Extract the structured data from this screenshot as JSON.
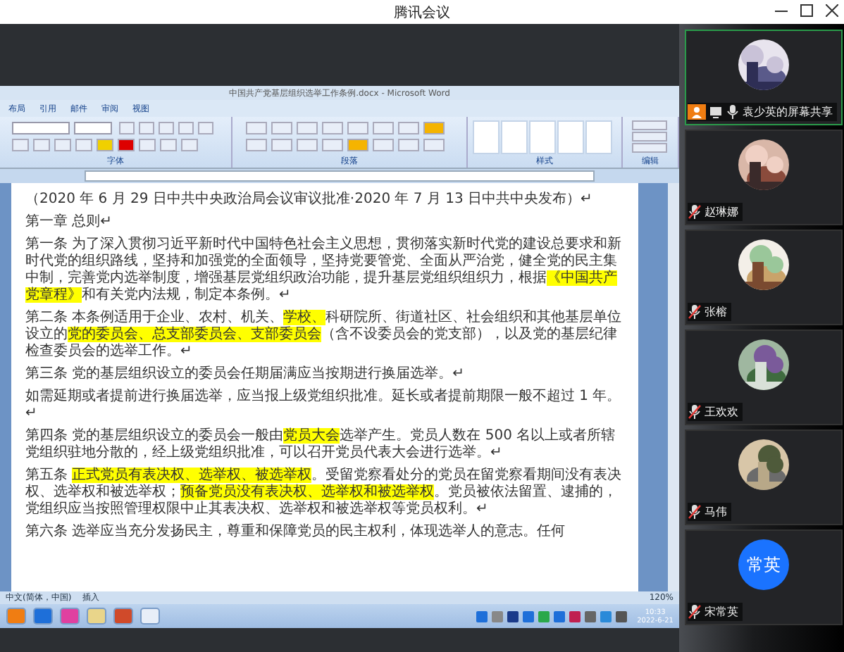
{
  "window": {
    "title": "腾讯会议"
  },
  "shared_screen": {
    "word": {
      "title": "中国共产党基层组织选举工作条例.docx - Microsoft Word",
      "tabs": [
        {
          "label": "布局",
          "selected": false
        },
        {
          "label": "引用",
          "selected": false
        },
        {
          "label": "邮件",
          "selected": false
        },
        {
          "label": "审阅",
          "selected": false
        },
        {
          "label": "视图",
          "selected": false
        }
      ],
      "ribbon_groups": [
        {
          "kind": "font",
          "label": "字体"
        },
        {
          "kind": "paragraph",
          "label": "段落"
        },
        {
          "kind": "styles",
          "label": "样式"
        },
        {
          "kind": "editing",
          "label": "编辑"
        }
      ],
      "document": [
        {
          "segments": [
            {
              "text": "（2020 年 6 月 29 日中共中央政治局会议审议批准·2020 年 7 月 13 日中共中央发布）↵",
              "highlight": false
            }
          ]
        },
        {
          "segments": [
            {
              "text": "第一章 总则↵",
              "highlight": false
            }
          ]
        },
        {
          "segments": [
            {
              "text": "第一条 为了深入贯彻习近平新时代中国特色社会主义思想，贯彻落实新时代党的建设总要求和新时代党的组织路线，坚持和加强党的全面领导，坚持党要管党、全面从严治党，健全党的民主集中制，完善党内选举制度，增强基层党组织政治功能，提升基层党组织组织力，根据",
              "highlight": false
            },
            {
              "text": "《中国共产党章程》",
              "highlight": true
            },
            {
              "text": "和有关党内法规，制定本条例。↵",
              "highlight": false
            }
          ]
        },
        {
          "segments": [
            {
              "text": "第二条 本条例适用于企业、农村、机关、",
              "highlight": false
            },
            {
              "text": "学校、",
              "highlight": true
            },
            {
              "text": "科研院所、街道社区、社会组织和其他基层单位设立的",
              "highlight": false
            },
            {
              "text": "党的委员会、总支部委员会、支部委员会",
              "highlight": true
            },
            {
              "text": "（含不设委员会的党支部），以及党的基层纪律检查委员会的选举工作。↵",
              "highlight": false
            }
          ]
        },
        {
          "segments": [
            {
              "text": "第三条 党的基层组织设立的委员会任期届满应当按期进行换届选举。↵",
              "highlight": false
            }
          ]
        },
        {
          "segments": [
            {
              "text": "如需延期或者提前进行换届选举，应当报上级党组织批准。延长或者提前期限一般不超过 1 年。↵",
              "highlight": false
            }
          ]
        },
        {
          "segments": [
            {
              "text": "第四条 党的基层组织设立的委员会一般由",
              "highlight": false
            },
            {
              "text": "党员大会",
              "highlight": true
            },
            {
              "text": "选举产生。党员人数在 500 名以上或者所辖党组织驻地分散的，经上级党组织批准，可以召开党员代表大会进行选举。↵",
              "highlight": false
            }
          ]
        },
        {
          "segments": [
            {
              "text": "第五条 ",
              "highlight": false
            },
            {
              "text": "正式党员有表决权、选举权、被选举权",
              "highlight": true
            },
            {
              "text": "。受留党察看处分的党员在留党察看期间没有表决权、选举权和被选举权；",
              "highlight": false
            },
            {
              "text": "预备党员没有表决权、选举权和被选举权",
              "highlight": true
            },
            {
              "text": "。党员被依法留置、逮捕的，党组织应当按照管理权限中止其表决权、选举权和被选举权等党员权利。↵",
              "highlight": false
            }
          ]
        },
        {
          "segments": [
            {
              "text": "第六条 选举应当充分发扬民主，尊重和保障党员的民主权利，体现选举人的意志。任何",
              "highlight": false
            }
          ]
        }
      ],
      "status_bar": {
        "language": "中文(简体，中国)",
        "mode": "插入",
        "zoom": "120%"
      }
    },
    "taskbar": {
      "time": "10:33",
      "date": "2022-6-21"
    }
  },
  "participants": [
    {
      "name": "袁少英的屏幕共享",
      "selected": true,
      "muted": false,
      "sharing": true
    },
    {
      "name": "赵琳娜",
      "selected": false,
      "muted": true,
      "sharing": false
    },
    {
      "name": "张榕",
      "selected": false,
      "muted": true,
      "sharing": false
    },
    {
      "name": "王欢欢",
      "selected": false,
      "muted": true,
      "sharing": false
    },
    {
      "name": "马伟",
      "selected": false,
      "muted": true,
      "sharing": false
    },
    {
      "name": "宋常英",
      "selected": false,
      "muted": true,
      "sharing": false,
      "avatar": {
        "kind": "initials",
        "text": "常英"
      }
    }
  ]
}
